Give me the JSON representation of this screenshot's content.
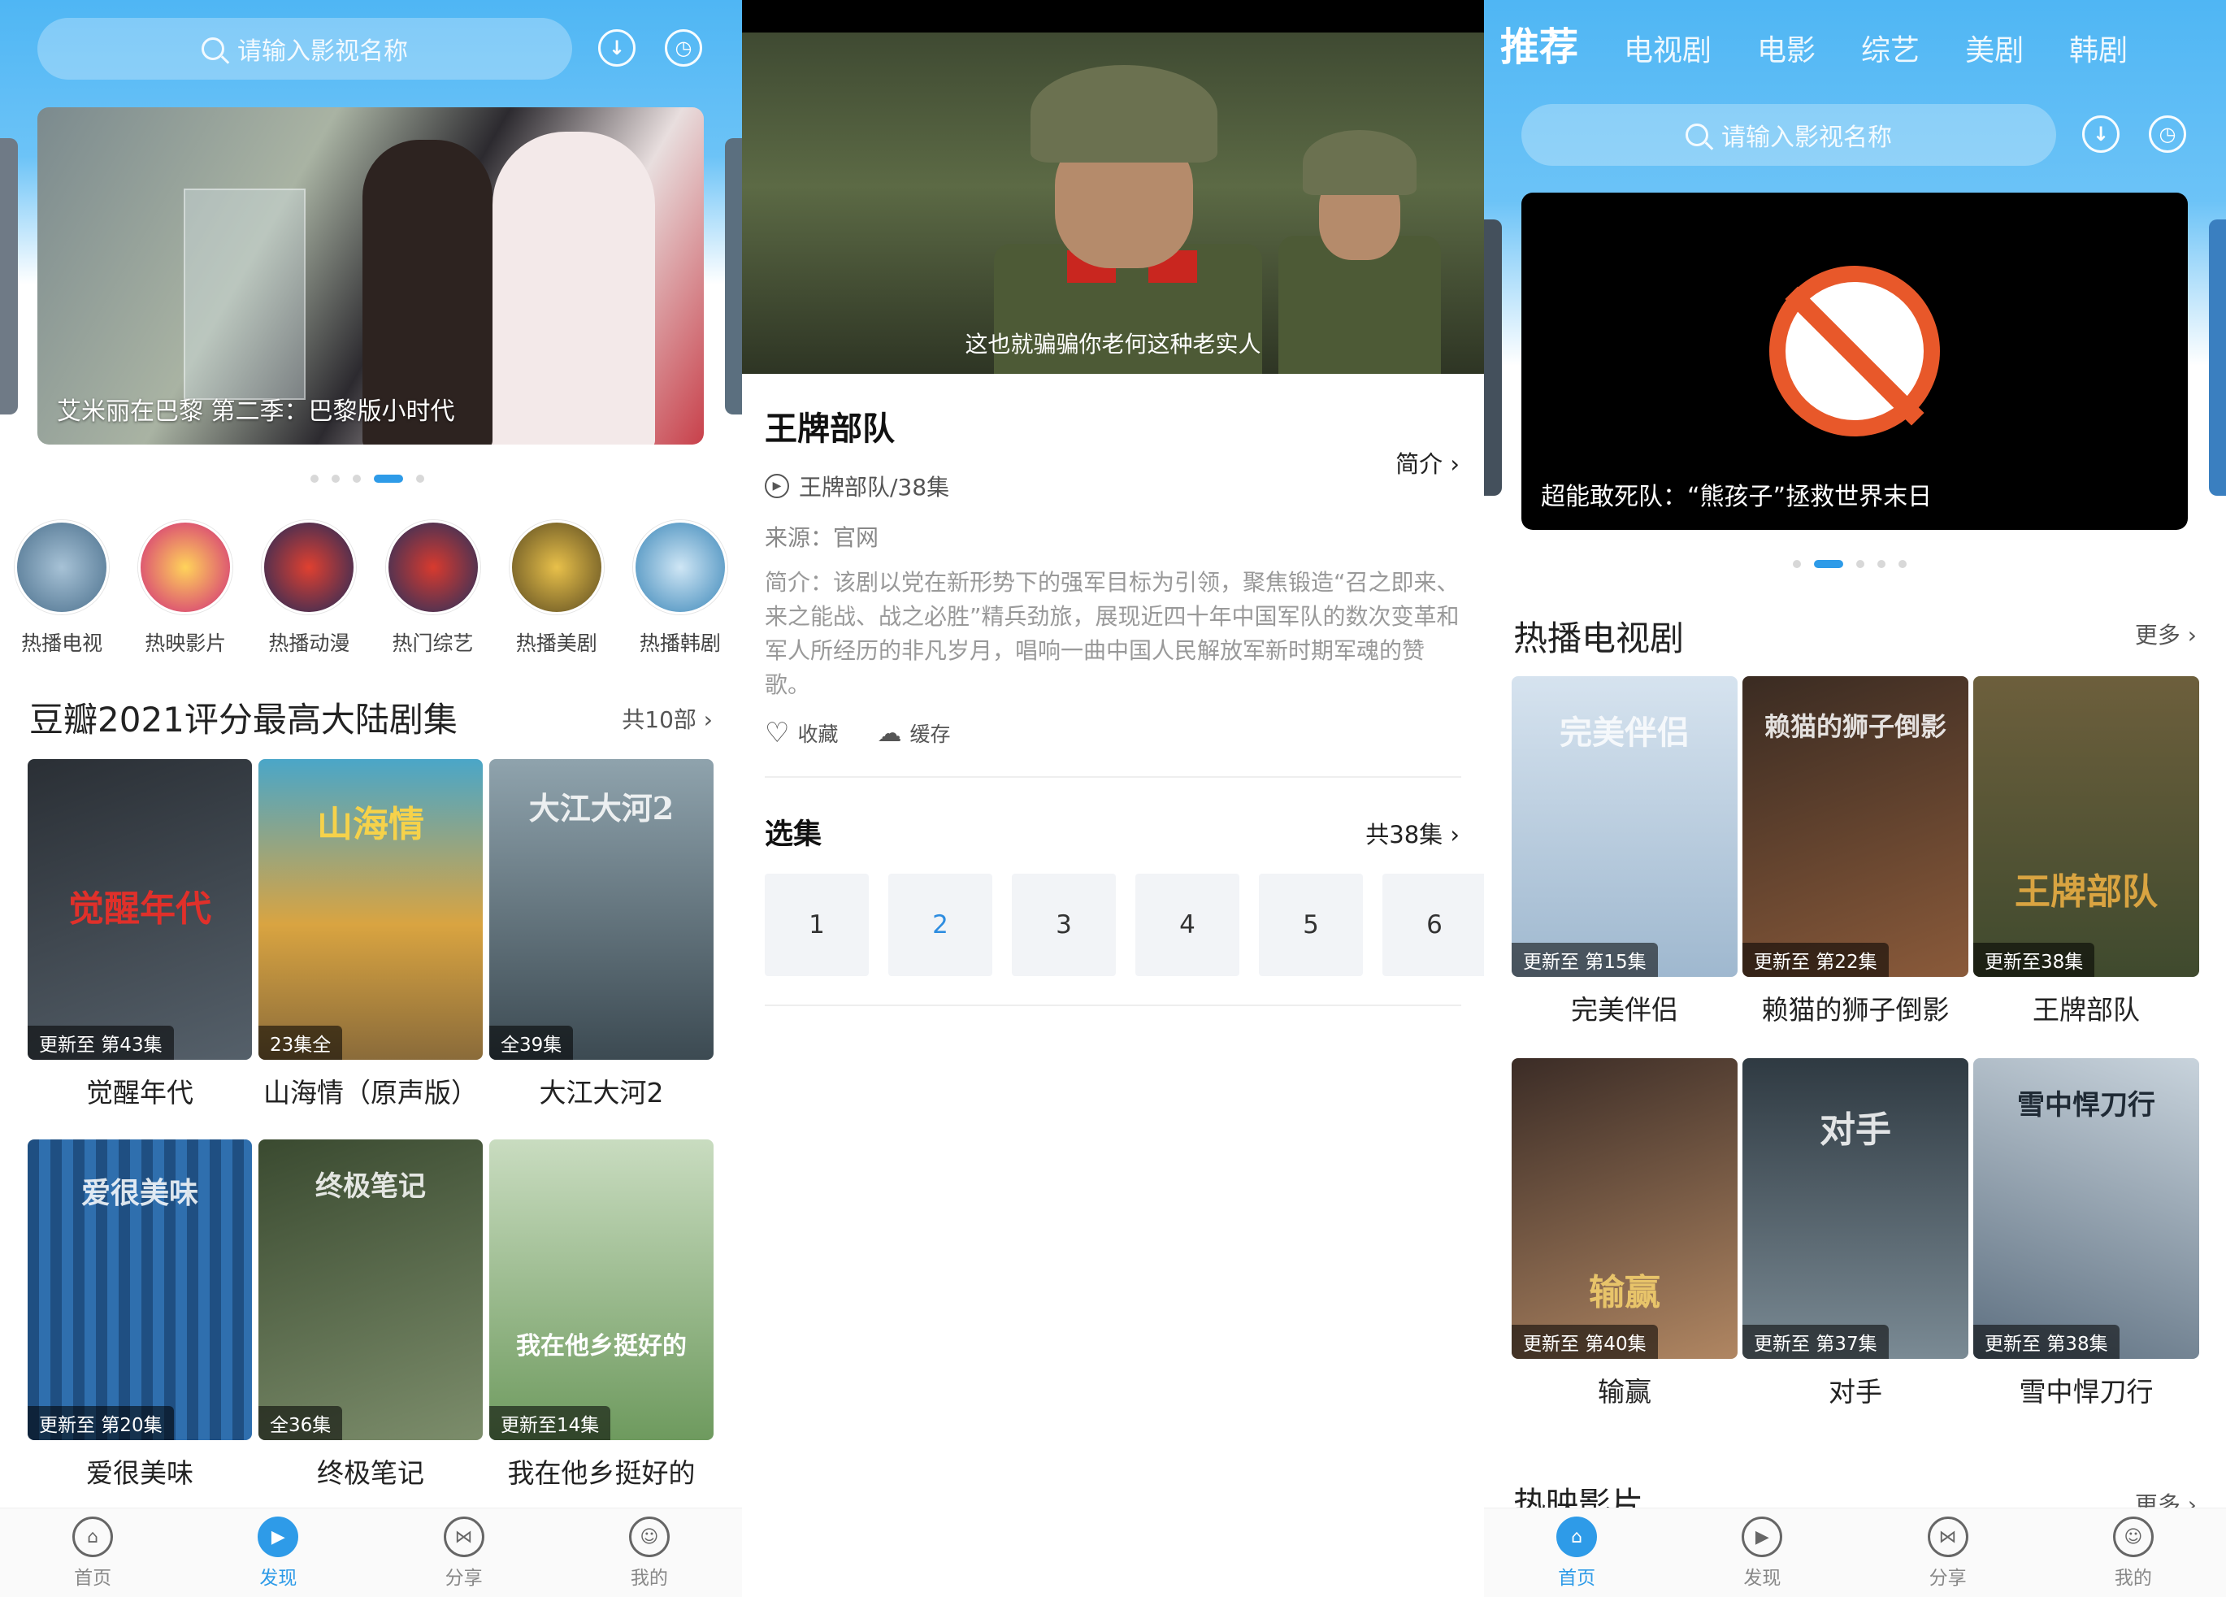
{
  "colors": {
    "accent": "#2e9be8",
    "header_blue": "#4fb6f4"
  },
  "search": {
    "placeholder": "请输入影视名称"
  },
  "icons": {
    "download": "download-icon",
    "history": "clock-icon",
    "search": "search-icon"
  },
  "left": {
    "banner_caption": "艾米丽在巴黎 第二季：巴黎版小时代",
    "categories": [
      {
        "label": "热播电视"
      },
      {
        "label": "热映影片"
      },
      {
        "label": "热播动漫"
      },
      {
        "label": "热门综艺"
      },
      {
        "label": "热播美剧"
      },
      {
        "label": "热播韩剧"
      }
    ],
    "section": {
      "title": "豆瓣2021评分最高大陆剧集",
      "more": "共10部 ›"
    },
    "shows": [
      {
        "name": "觉醒年代",
        "tag": "更新至 第43集",
        "art": "觉醒年代",
        "c1": "#2a2f35",
        "c2": "#55606a"
      },
      {
        "name": "山海情（原声版）",
        "tag": "23集全",
        "art": "山海情",
        "c1": "#4aa6c8",
        "c2": "#d9a441"
      },
      {
        "name": "大江大河2",
        "tag": "全39集",
        "art": "大江大河2",
        "c1": "#8fa3ad",
        "c2": "#3c4a52"
      },
      {
        "name": "爱很美味",
        "tag": "更新至 第20集",
        "art": "爱很美味",
        "c1": "#1f4f82",
        "c2": "#2f6fae"
      },
      {
        "name": "终极笔记",
        "tag": "全36集",
        "art": "终极笔记",
        "c1": "#3a4a30",
        "c2": "#7c8d6b"
      },
      {
        "name": "我在他乡挺好的",
        "tag": "更新至14集",
        "art": "我在他乡挺好的",
        "c1": "#c9dcc0",
        "c2": "#6e9a5e"
      }
    ],
    "tabs": [
      {
        "label": "首页",
        "glyph": "⌂"
      },
      {
        "label": "发现",
        "glyph": "▶"
      },
      {
        "label": "分享",
        "glyph": "⋈"
      },
      {
        "label": "我的",
        "glyph": "☺"
      }
    ]
  },
  "middle": {
    "subtitle": "这也就骗骗你老何这种老实人",
    "title": "王牌部队",
    "intro_link": "简介 ›",
    "episodes_line": "王牌部队/38集",
    "source": "来源：官网",
    "description": "简介：该剧以党在新形势下的强军目标为引领，聚焦锻造“召之即来、来之能战、战之必胜”精兵劲旅，展现近四十年中国军队的数次变革和军人所经历的非凡岁月，唱响一曲中国人民解放军新时期军魂的赞歌。",
    "actions": {
      "favorite": "收藏",
      "cache": "缓存"
    },
    "ep_section": {
      "title": "选集",
      "count": "共38集 ›"
    },
    "episodes": [
      "1",
      "2",
      "3",
      "4",
      "5",
      "6"
    ],
    "selected_episode": "2"
  },
  "right": {
    "nav": [
      "推荐",
      "电视剧",
      "电影",
      "综艺",
      "美剧",
      "韩剧"
    ],
    "banner_caption": "超能敢死队：“熊孩子”拯救世界末日",
    "section": {
      "title": "热播电视剧",
      "more": "更多 ›"
    },
    "shows": [
      {
        "name": "完美伴侣",
        "tag": "更新至 第15集",
        "art": "完美伴侣",
        "c1": "#d6e3ef",
        "c2": "#9fb8cf"
      },
      {
        "name": "赖猫的狮子倒影",
        "tag": "更新至 第22集",
        "art": "赖猫的狮子倒影",
        "c1": "#3a2b22",
        "c2": "#8a5a3a"
      },
      {
        "name": "王牌部队",
        "tag": "更新至38集",
        "art": "王牌部队",
        "c1": "#6d5f3c",
        "c2": "#3f4a2e"
      },
      {
        "name": "输赢",
        "tag": "更新至 第40集",
        "art": "输赢",
        "c1": "#3b2c26",
        "c2": "#b08662"
      },
      {
        "name": "对手",
        "tag": "更新至 第37集",
        "art": "对手",
        "c1": "#2f3a42",
        "c2": "#7a8a94"
      },
      {
        "name": "雪中悍刀行",
        "tag": "更新至 第38集",
        "art": "雪中悍刀行",
        "c1": "#c8d3dc",
        "c2": "#5d6f80"
      }
    ],
    "section2": {
      "title": "热映影片",
      "more": "更多 ›"
    },
    "tabs": [
      {
        "label": "首页",
        "glyph": "⌂"
      },
      {
        "label": "发现",
        "glyph": "▶"
      },
      {
        "label": "分享",
        "glyph": "⋈"
      },
      {
        "label": "我的",
        "glyph": "☺"
      }
    ]
  }
}
